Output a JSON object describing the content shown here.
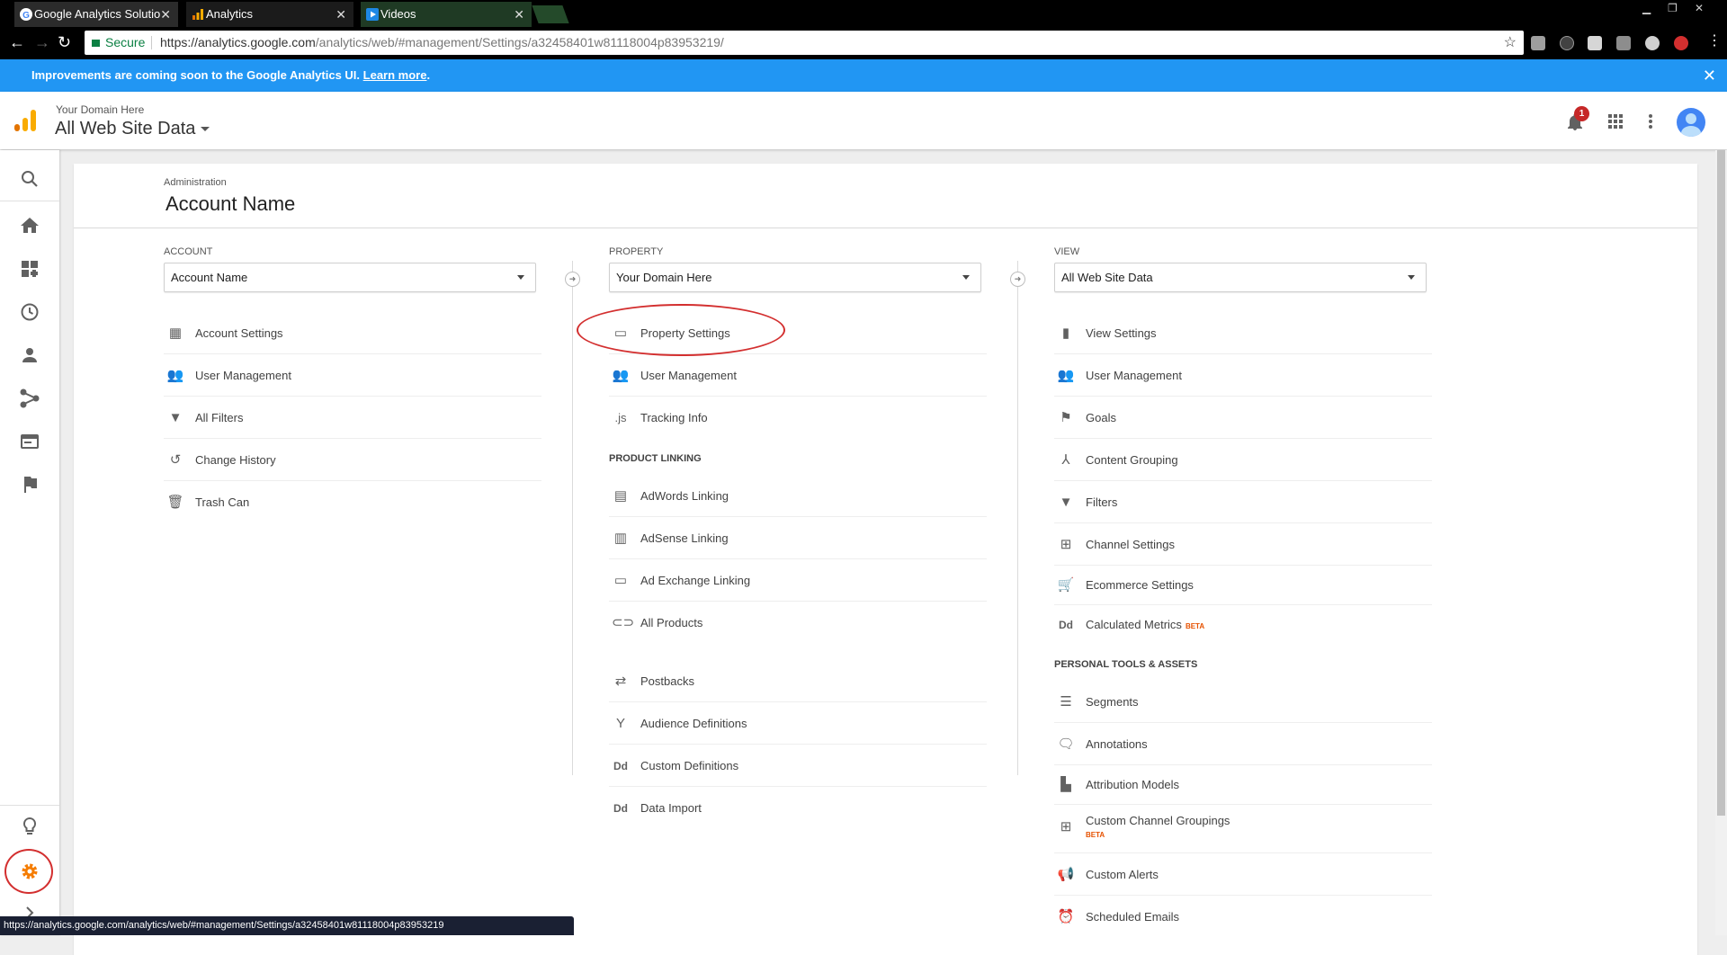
{
  "browser": {
    "tabs": [
      {
        "label": "Google Analytics Solutio",
        "icon": "google-icon"
      },
      {
        "label": "Analytics",
        "icon": "analytics-icon"
      },
      {
        "label": "Videos",
        "icon": "play-icon"
      }
    ],
    "secure_label": "Secure",
    "url_base": "https://analytics.google.com",
    "url_path": "/analytics/web/#management/Settings/a32458401w81118004p83953219/"
  },
  "banner": {
    "text": "Improvements are coming soon to the Google Analytics UI.",
    "link": "Learn more",
    "suffix": "."
  },
  "header": {
    "domain_small": "Your Domain Here",
    "view_name": "All Web Site Data",
    "notification_count": "1",
    "accent": "#f9ab00"
  },
  "page": {
    "breadcrumb": "Administration",
    "title": "Account Name"
  },
  "account": {
    "label": "ACCOUNT",
    "selected": "Account Name",
    "items": [
      {
        "label": "Account Settings",
        "icon": "building-icon"
      },
      {
        "label": "User Management",
        "icon": "users-icon"
      },
      {
        "label": "All Filters",
        "icon": "filter-icon"
      },
      {
        "label": "Change History",
        "icon": "history-icon"
      },
      {
        "label": "Trash Can",
        "icon": "trash-icon"
      }
    ]
  },
  "property": {
    "label": "PROPERTY",
    "selected": "Your Domain Here",
    "items": [
      {
        "label": "Property Settings",
        "icon": "property-settings-icon"
      },
      {
        "label": "User Management",
        "icon": "users-icon"
      },
      {
        "label": "Tracking Info",
        "icon": "js-icon"
      }
    ],
    "linking_header": "PRODUCT LINKING",
    "linking_items": [
      {
        "label": "AdWords Linking",
        "icon": "adwords-icon"
      },
      {
        "label": "AdSense Linking",
        "icon": "adsense-icon"
      },
      {
        "label": "Ad Exchange Linking",
        "icon": "adexchange-icon"
      },
      {
        "label": "All Products",
        "icon": "link-icon"
      }
    ],
    "other_items": [
      {
        "label": "Postbacks",
        "icon": "postbacks-icon"
      },
      {
        "label": "Audience Definitions",
        "icon": "audience-icon"
      },
      {
        "label": "Custom Definitions",
        "icon": "dd-icon"
      },
      {
        "label": "Data Import",
        "icon": "dd-icon"
      }
    ]
  },
  "view": {
    "label": "VIEW",
    "selected": "All Web Site Data",
    "items": [
      {
        "label": "View Settings",
        "icon": "document-icon"
      },
      {
        "label": "User Management",
        "icon": "users-icon"
      },
      {
        "label": "Goals",
        "icon": "flag-icon"
      },
      {
        "label": "Content Grouping",
        "icon": "content-grouping-icon"
      },
      {
        "label": "Filters",
        "icon": "filter-icon"
      },
      {
        "label": "Channel Settings",
        "icon": "channel-icon"
      },
      {
        "label": "Ecommerce Settings",
        "icon": "cart-icon"
      },
      {
        "label": "Calculated Metrics",
        "icon": "dd-icon",
        "badge": "BETA"
      }
    ],
    "personal_header": "PERSONAL TOOLS & ASSETS",
    "personal_items": [
      {
        "label": "Segments",
        "icon": "segments-icon"
      },
      {
        "label": "Annotations",
        "icon": "comment-icon"
      },
      {
        "label": "Attribution Models",
        "icon": "bar-chart-icon"
      },
      {
        "label": "Custom Channel Groupings",
        "icon": "channel-icon",
        "badge": "BETA"
      },
      {
        "label": "Custom Alerts",
        "icon": "megaphone-icon"
      },
      {
        "label": "Scheduled Emails",
        "icon": "alarm-icon"
      }
    ]
  },
  "status_url": "https://analytics.google.com/analytics/web/#management/Settings/a32458401w81118004p83953219"
}
